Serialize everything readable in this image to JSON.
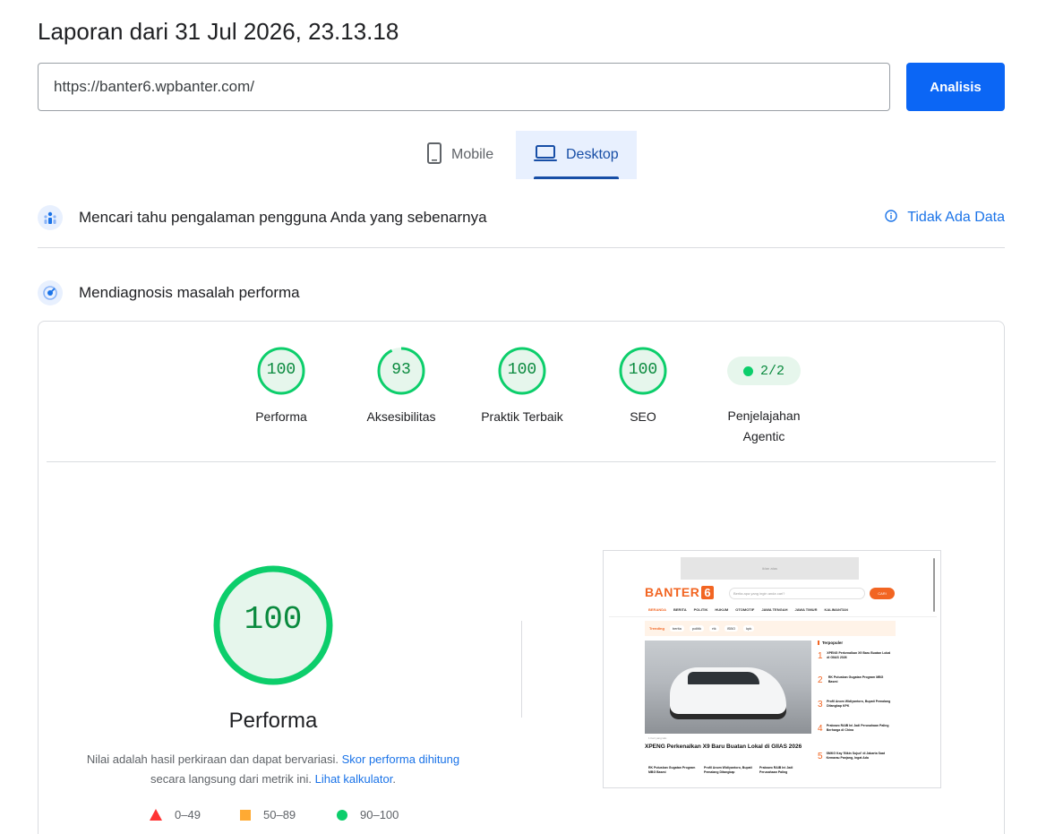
{
  "report": {
    "title": "Laporan dari 31 Jul 2026, 23.13.18"
  },
  "url_bar": {
    "value": "https://banter6.wpbanter.com/",
    "button_label": "Analisis"
  },
  "tabs": [
    {
      "label": "Mobile",
      "icon": "phone-icon",
      "selected": false
    },
    {
      "label": "Desktop",
      "icon": "laptop-icon",
      "selected": true
    }
  ],
  "field_data": {
    "title": "Mencari tahu pengalaman pengguna Anda yang sebenarnya",
    "status": "Tidak Ada Data",
    "icon": "users-icon"
  },
  "lab_data": {
    "title": "Mendiagnosis masalah performa",
    "icon": "diagnostics-icon"
  },
  "scores": [
    {
      "label": "Performa",
      "value": "100",
      "fraction": 1.0
    },
    {
      "label": "Aksesibilitas",
      "value": "93",
      "fraction": 0.93
    },
    {
      "label": "Praktik Terbaik",
      "value": "100",
      "fraction": 1.0
    },
    {
      "label": "SEO",
      "value": "100",
      "fraction": 1.0
    }
  ],
  "agentic": {
    "label": "Penjelajahan Agentic",
    "value": "2/2"
  },
  "performance": {
    "score": "100",
    "label": "Performa",
    "note_prefix": "Nilai adalah hasil perkiraan dan dapat bervariasi.",
    "note_link1": "Skor performa dihitung",
    "note_middle": "secara langsung dari metrik ini.",
    "note_link2": "Lihat kalkulator",
    "note_suffix": "."
  },
  "legend": [
    {
      "range": "0–49",
      "color": "#ff3333"
    },
    {
      "range": "50–89",
      "color": "#ffaa33"
    },
    {
      "range": "90–100",
      "color": "#0cce6b"
    }
  ],
  "colors": {
    "accent": "#1a73e8",
    "pass": "#0cce6b",
    "pass_text": "#0a8a3e"
  },
  "screenshot": {
    "ad_text": "iklan atas",
    "logo_text": "BANTER",
    "logo_num": "6",
    "search_placeholder": "Berita apa yang ingin anda cari?",
    "search_button": "CARI",
    "nav": [
      "BERANDA",
      "BERITA",
      "POLITIK",
      "HUKUM",
      "OTOMOTIF",
      "JAWA TENGAH",
      "JAWA TIMUR",
      "KALIMANTAN"
    ],
    "trending_label": "Trending",
    "trending_tags": [
      "berita",
      "politik",
      "rtk",
      "ISBO",
      "kpk"
    ],
    "hero_time": "1 hari yang lalu",
    "hero_caption": "XPENG Perkenalkan X9 Baru Buatan Lokal di GIIAS 2026",
    "sub_items": [
      "RK Putuskan Gugatan Program MBG Basmi",
      "Profil Anom Widiyantoro, Bupati Pemalang Ditangkap",
      "Prabowo RAIB Ini Jadi Perusahaan Paling"
    ],
    "popular_title": "Terpopuler",
    "popular": [
      {
        "n": "1",
        "t": "XPENG Perkenalkan X9 Baru Buatan Lokal di GIIAS 2026"
      },
      {
        "n": "2",
        "t": "RK Putuskan Gugatan Program MBG Basmi"
      },
      {
        "n": "3",
        "t": "Profil Anom Widiyantoro, Bupati Pemalang Ditangkap KPK"
      },
      {
        "n": "4",
        "t": "Prabowo RAIB Ini Jadi Perusahaan Paling Berharga di China"
      },
      {
        "n": "5",
        "t": "SMKG Kay 'Bikin Sujud' di Jakarta Saat Kemarau Panjang, Ingat Ada"
      }
    ]
  }
}
